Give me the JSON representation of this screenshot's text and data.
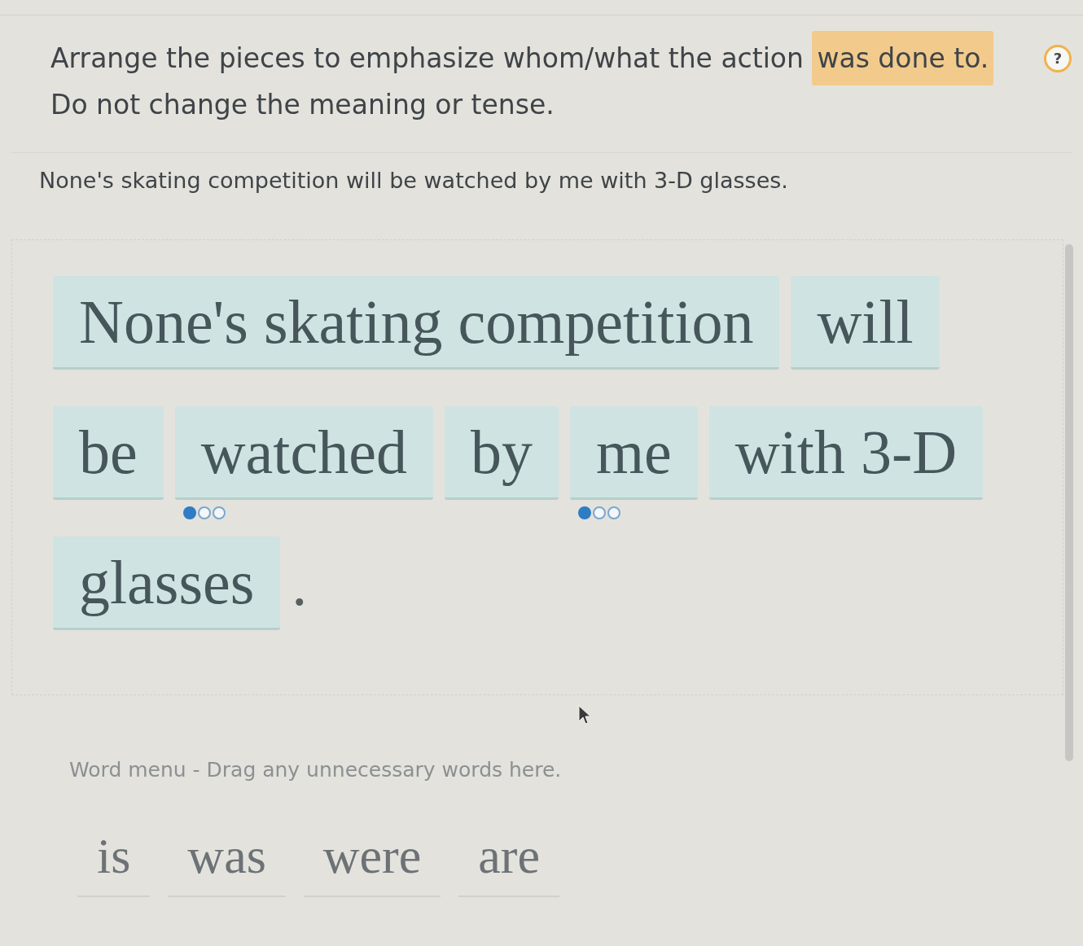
{
  "instruction": {
    "segments": [
      {
        "text": "Arrange the pieces to emphasize whom/what the action ",
        "highlighted": false
      },
      {
        "text": "was done to.",
        "highlighted": true
      }
    ],
    "note": "Do not change the meaning or tense."
  },
  "help_button": {
    "label": "?"
  },
  "sentence": "None's skating competition will be watched by me with 3-D glasses.",
  "answer_pieces": [
    {
      "kind": "tile",
      "text": "None's skating competition"
    },
    {
      "kind": "tile",
      "text": "will"
    },
    {
      "kind": "tile",
      "text": "be"
    },
    {
      "kind": "tile",
      "text": "watched",
      "dots": [
        {
          "filled": true
        },
        {
          "filled": false
        },
        {
          "filled": false
        }
      ]
    },
    {
      "kind": "tile",
      "text": "by"
    },
    {
      "kind": "tile",
      "text": "me",
      "dots": [
        {
          "filled": true
        },
        {
          "filled": false
        },
        {
          "filled": false
        }
      ]
    },
    {
      "kind": "tile",
      "text": "with 3-D"
    },
    {
      "kind": "tile",
      "text": "glasses"
    },
    {
      "kind": "punctuation",
      "text": "."
    }
  ],
  "word_menu": {
    "label": "Word menu - Drag any unnecessary words here.",
    "words": [
      "is",
      "was",
      "were",
      "are"
    ]
  }
}
